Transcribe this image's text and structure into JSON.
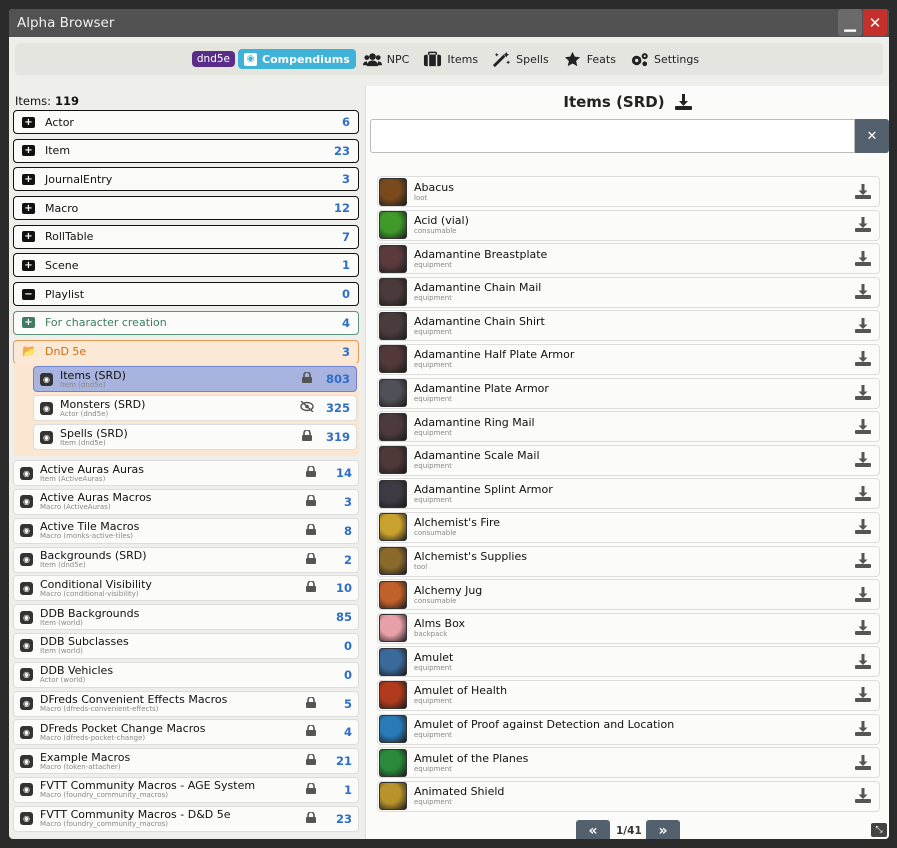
{
  "window": {
    "title": "Alpha Browser",
    "minimize": "▁",
    "close": "✕"
  },
  "tabs": {
    "system_badge": "dnd5e",
    "items": [
      {
        "label": "Compendiums",
        "active": true
      },
      {
        "label": "NPC"
      },
      {
        "label": "Items"
      },
      {
        "label": "Spells"
      },
      {
        "label": "Feats"
      },
      {
        "label": "Settings"
      }
    ]
  },
  "sidebar": {
    "items_label": "Items:",
    "items_count": "119",
    "folders": [
      {
        "name": "Actor",
        "count": "6"
      },
      {
        "name": "Item",
        "count": "23"
      },
      {
        "name": "JournalEntry",
        "count": "3"
      },
      {
        "name": "Macro",
        "count": "12"
      },
      {
        "name": "RollTable",
        "count": "7"
      },
      {
        "name": "Scene",
        "count": "1"
      },
      {
        "name": "Playlist",
        "count": "0"
      }
    ],
    "green_folder": {
      "name": "For character creation",
      "count": "4"
    },
    "orange_folder": {
      "name": "DnD 5e",
      "count": "3"
    },
    "sub_packs": [
      {
        "name": "Items (SRD)",
        "sub": "Item (dnd5e)",
        "count": "803",
        "icon": "lock-icon",
        "selected": true
      },
      {
        "name": "Monsters (SRD)",
        "sub": "Actor (dnd5e)",
        "count": "325",
        "icon": "eye-slash-icon"
      },
      {
        "name": "Spells (SRD)",
        "sub": "Item (dnd5e)",
        "count": "319",
        "icon": "lock-icon"
      }
    ],
    "packs": [
      {
        "name": "Active Auras Auras",
        "sub": "Item (ActiveAuras)",
        "count": "14",
        "lock": true
      },
      {
        "name": "Active Auras Macros",
        "sub": "Macro (ActiveAuras)",
        "count": "3",
        "lock": true
      },
      {
        "name": "Active Tile Macros",
        "sub": "Macro (monks-active-tiles)",
        "count": "8",
        "lock": true
      },
      {
        "name": "Backgrounds (SRD)",
        "sub": "Item (dnd5e)",
        "count": "2",
        "lock": true
      },
      {
        "name": "Conditional Visibility",
        "sub": "Macro (conditional-visibility)",
        "count": "10",
        "lock": true
      },
      {
        "name": "DDB Backgrounds",
        "sub": "Item (world)",
        "count": "85",
        "lock": false
      },
      {
        "name": "DDB Subclasses",
        "sub": "Item (world)",
        "count": "0",
        "lock": false
      },
      {
        "name": "DDB Vehicles",
        "sub": "Actor (world)",
        "count": "0",
        "lock": false
      },
      {
        "name": "DFreds Convenient Effects Macros",
        "sub": "Macro (dfreds-convenient-effects)",
        "count": "5",
        "lock": true
      },
      {
        "name": "DFreds Pocket Change Macros",
        "sub": "Macro (dfreds-pocket-change)",
        "count": "4",
        "lock": true
      },
      {
        "name": "Example Macros",
        "sub": "Macro (token-attacher)",
        "count": "21",
        "lock": true
      },
      {
        "name": "FVTT Community Macros - AGE System",
        "sub": "Macro (foundry_community_macros)",
        "count": "1",
        "lock": true
      },
      {
        "name": "FVTT Community Macros - D&D 5e",
        "sub": "Macro (foundry_community_macros)",
        "count": "23",
        "lock": true
      }
    ]
  },
  "main": {
    "title": "Items (SRD)",
    "search": {
      "value": "",
      "placeholder": ""
    },
    "entries": [
      {
        "name": "Abacus",
        "type": "loot",
        "color": "#7a4a1c"
      },
      {
        "name": "Acid (vial)",
        "type": "consumable",
        "color": "#3f9a2a"
      },
      {
        "name": "Adamantine Breastplate",
        "type": "equipment",
        "color": "#5a3a3a"
      },
      {
        "name": "Adamantine Chain Mail",
        "type": "equipment",
        "color": "#4a3a3a"
      },
      {
        "name": "Adamantine Chain Shirt",
        "type": "equipment",
        "color": "#4b3c3c"
      },
      {
        "name": "Adamantine Half Plate Armor",
        "type": "equipment",
        "color": "#523838"
      },
      {
        "name": "Adamantine Plate Armor",
        "type": "equipment",
        "color": "#505058"
      },
      {
        "name": "Adamantine Ring Mail",
        "type": "equipment",
        "color": "#4c3a3e"
      },
      {
        "name": "Adamantine Scale Mail",
        "type": "equipment",
        "color": "#4e3838"
      },
      {
        "name": "Adamantine Splint Armor",
        "type": "equipment",
        "color": "#3e3a44"
      },
      {
        "name": "Alchemist's Fire",
        "type": "consumable",
        "color": "#c9a12e"
      },
      {
        "name": "Alchemist's Supplies",
        "type": "tool",
        "color": "#8a6a2a"
      },
      {
        "name": "Alchemy Jug",
        "type": "consumable",
        "color": "#c0602a"
      },
      {
        "name": "Alms Box",
        "type": "backpack",
        "color": "#e8a0a8"
      },
      {
        "name": "Amulet",
        "type": "equipment",
        "color": "#3a6a9a"
      },
      {
        "name": "Amulet of Health",
        "type": "equipment",
        "color": "#b03a1c"
      },
      {
        "name": "Amulet of Proof against Detection and Location",
        "type": "equipment",
        "color": "#2a7ab8"
      },
      {
        "name": "Amulet of the Planes",
        "type": "equipment",
        "color": "#2a8a3a"
      },
      {
        "name": "Animated Shield",
        "type": "equipment",
        "color": "#b8922a"
      }
    ]
  },
  "pager": {
    "prev": "«",
    "page": "1/41",
    "next": "»"
  }
}
